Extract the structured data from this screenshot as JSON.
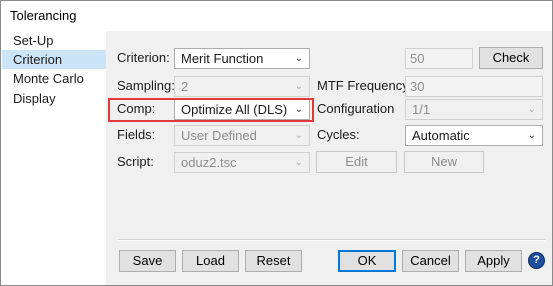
{
  "window": {
    "title": "Tolerancing"
  },
  "sidebar": {
    "items": [
      {
        "label": "Set-Up",
        "selected": false
      },
      {
        "label": "Criterion",
        "selected": true
      },
      {
        "label": "Monte Carlo",
        "selected": false
      },
      {
        "label": "Display",
        "selected": false
      }
    ]
  },
  "form": {
    "criterion": {
      "label": "Criterion:",
      "value": "Merit Function"
    },
    "criterion_number": {
      "value": "50"
    },
    "check_button": "Check",
    "sampling": {
      "label": "Sampling:",
      "value": "2"
    },
    "mtf_frequency": {
      "label": "MTF Frequency:",
      "value": "30"
    },
    "comp": {
      "label": "Comp:",
      "value": "Optimize All (DLS)"
    },
    "configuration": {
      "label": "Configuration",
      "value": "1/1"
    },
    "fields": {
      "label": "Fields:",
      "value": "User Defined"
    },
    "cycles": {
      "label": "Cycles:",
      "value": "Automatic"
    },
    "script": {
      "label": "Script:",
      "value": "oduz2.tsc"
    },
    "edit_button": "Edit",
    "new_button": "New"
  },
  "footer": {
    "save": "Save",
    "load": "Load",
    "reset": "Reset",
    "ok": "OK",
    "cancel": "Cancel",
    "apply": "Apply",
    "help": "?"
  },
  "colors": {
    "selection": "#cce4f7",
    "highlight_box": "#e0393b",
    "panel_bg": "#f0f0f0",
    "default_button_border": "#0078d7",
    "help_icon": "#1f4e9c"
  }
}
